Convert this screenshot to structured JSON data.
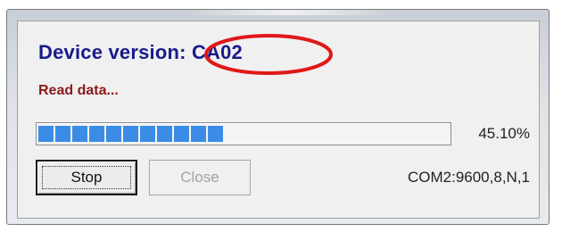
{
  "dialog": {
    "device_version": "Device version: CA02",
    "status": "Read data...",
    "progress": {
      "value": 0.451,
      "percent_label": "45.10%",
      "color": "#3c8ce6"
    },
    "port_status": "COM2:9600,8,N,1"
  },
  "buttons": {
    "stop_label": "Stop",
    "close_label": "Close"
  },
  "annotation": {
    "color": "#e01818",
    "shape": "ellipse"
  }
}
